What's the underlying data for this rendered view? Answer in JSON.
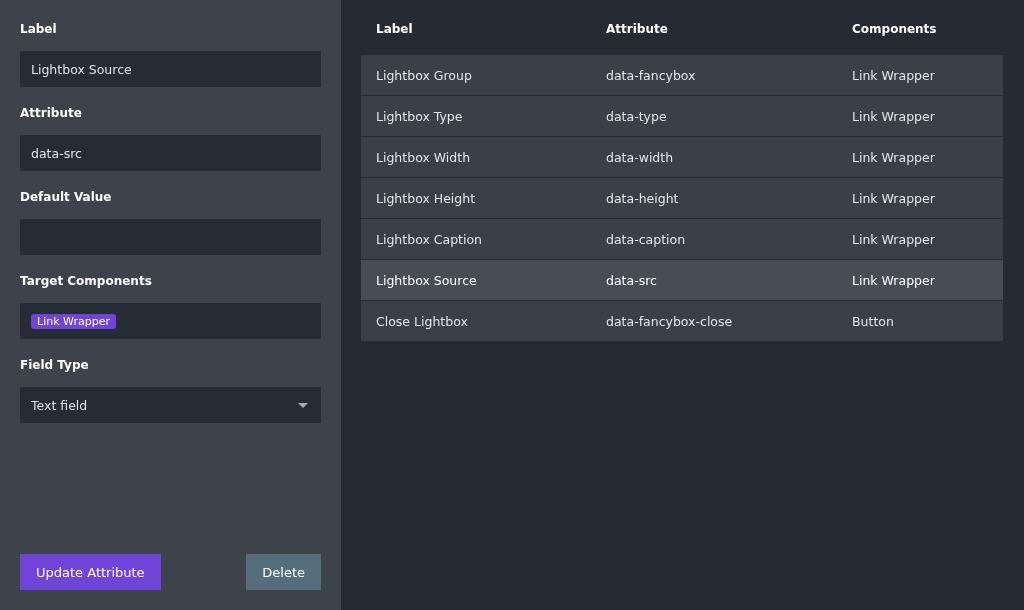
{
  "form": {
    "fields": [
      {
        "kind": "text",
        "label": "Label",
        "value": "Lightbox Source"
      },
      {
        "kind": "text",
        "label": "Attribute",
        "value": "data-src"
      },
      {
        "kind": "text",
        "label": "Default Value"
      },
      {
        "kind": "tags",
        "label": "Target Components",
        "tags": [
          "Link Wrapper"
        ]
      },
      {
        "kind": "select",
        "label": "Field Type",
        "value": "Text field"
      }
    ],
    "buttons": [
      {
        "kind": "primary",
        "label": "Update Attribute"
      },
      {
        "kind": "secondary",
        "label": "Delete"
      }
    ]
  },
  "table": {
    "columns": [
      "Label",
      "Attribute",
      "Components"
    ],
    "rows": [
      {
        "cells": [
          "Lightbox Group",
          "data-fancybox",
          "Link Wrapper"
        ],
        "selected": false
      },
      {
        "cells": [
          "Lightbox Type",
          "data-type",
          "Link Wrapper"
        ],
        "selected": false
      },
      {
        "cells": [
          "Lightbox Width",
          "data-width",
          "Link Wrapper"
        ],
        "selected": false
      },
      {
        "cells": [
          "Lightbox Height",
          "data-height",
          "Link Wrapper"
        ],
        "selected": false
      },
      {
        "cells": [
          "Lightbox Caption",
          "data-caption",
          "Link Wrapper"
        ],
        "selected": false
      },
      {
        "cells": [
          "Lightbox Source",
          "data-src",
          "Link Wrapper"
        ],
        "selected": true
      },
      {
        "cells": [
          "Close Lightbox",
          "data-fancybox-close",
          "Button"
        ],
        "selected": false
      }
    ]
  }
}
